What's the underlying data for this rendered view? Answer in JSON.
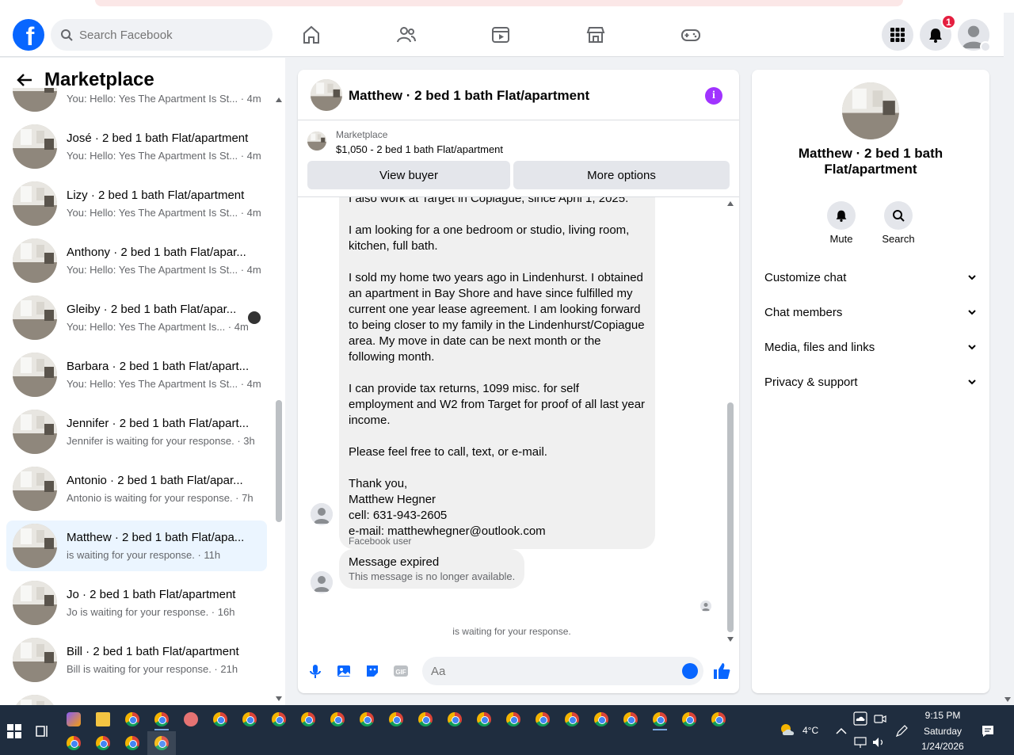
{
  "colors": {
    "brand": "#0866ff",
    "accent_purple": "#a033ff",
    "badge_red": "#e41e3f",
    "active_bg": "#ebf5ff"
  },
  "topnav": {
    "logo": "f",
    "search_placeholder": "Search Facebook",
    "notifications_count": "1",
    "icons": [
      "home-icon",
      "friends-icon",
      "video-icon",
      "marketplace-icon",
      "gaming-icon",
      "menu-grid-icon",
      "bell-icon",
      "account-avatar"
    ]
  },
  "left": {
    "title": "Marketplace",
    "conversations": [
      {
        "name": "",
        "sub": "You: Hello: Yes The Apartment Is St... · 4m"
      },
      {
        "name": "José · 2 bed 1 bath Flat/apartment",
        "sub": "You: Hello: Yes The Apartment Is St... · 4m"
      },
      {
        "name": "Lizy · 2 bed 1 bath Flat/apartment",
        "sub": "You: Hello: Yes The Apartment Is St... · 4m"
      },
      {
        "name": "Anthony · 2 bed 1 bath Flat/apar...",
        "sub": "You: Hello: Yes The Apartment Is St... · 4m"
      },
      {
        "name": "Gleiby · 2 bed 1 bath Flat/apar...",
        "sub": "You: Hello: Yes The Apartment Is... · 4m"
      },
      {
        "name": "Barbara · 2 bed 1 bath Flat/apart...",
        "sub": "You: Hello: Yes The Apartment Is St... · 4m"
      },
      {
        "name": "Jennifer · 2 bed 1 bath Flat/apart...",
        "sub": "Jennifer is waiting for your response. · 3h"
      },
      {
        "name": "Antonio · 2 bed 1 bath Flat/apar...",
        "sub": "Antonio is waiting for your response. · 7h"
      },
      {
        "name": "Matthew · 2 bed 1 bath Flat/apa...",
        "sub": "is waiting for your response. · 11h"
      },
      {
        "name": "Jo · 2 bed 1 bath Flat/apartment",
        "sub": "Jo is waiting for your response. · 16h"
      },
      {
        "name": "Bill · 2 bed 1 bath Flat/apartment",
        "sub": "Bill is waiting for your response. · 21h"
      }
    ]
  },
  "chat": {
    "title": "Matthew · 2 bed 1 bath Flat/apartment",
    "info_glyph": "i",
    "marketplace_label": "Marketplace",
    "listing_price": "$1,050 - 2 bed 1 bath Flat/apartment",
    "view_buyer": "View buyer",
    "more_options": "More options",
    "partial_line": "I also work at Target in Copiague, since April 1, 2025.",
    "paragraphs": [
      "I am looking for a one bedroom or studio, living room, kitchen, full bath.",
      "I sold my home two years ago in Lindenhurst. I obtained an apartment in Bay Shore and have since fulfilled my current one year lease agreement. I am looking forward to being closer to my family in the Lindenhurst/Copiague area. My move in date can be next month or the following month.",
      "I can provide tax returns, 1099 misc. for self employment and W2 from Target for proof of all last year income.",
      "Please feel free to call, text, or e-mail."
    ],
    "signoff": [
      "Thank you,",
      "Matthew Hegner",
      "cell: 631-943-2605",
      "e-mail: matthewhegner@outlook.com"
    ],
    "fb_user_label": "Facebook user",
    "expired_title": "Message expired",
    "expired_sub": "This message is no longer available.",
    "waiting": "is waiting for your response.",
    "composer_placeholder": "Aa"
  },
  "right": {
    "title": "Matthew · 2 bed 1 bath Flat/apartment",
    "mute": "Mute",
    "search": "Search",
    "rows": [
      "Customize chat",
      "Chat members",
      "Media, files and links",
      "Privacy & support"
    ]
  },
  "taskbar": {
    "temperature": "4°C",
    "time": "9:15 PM",
    "day": "Saturday",
    "date": "1/24/2026"
  }
}
